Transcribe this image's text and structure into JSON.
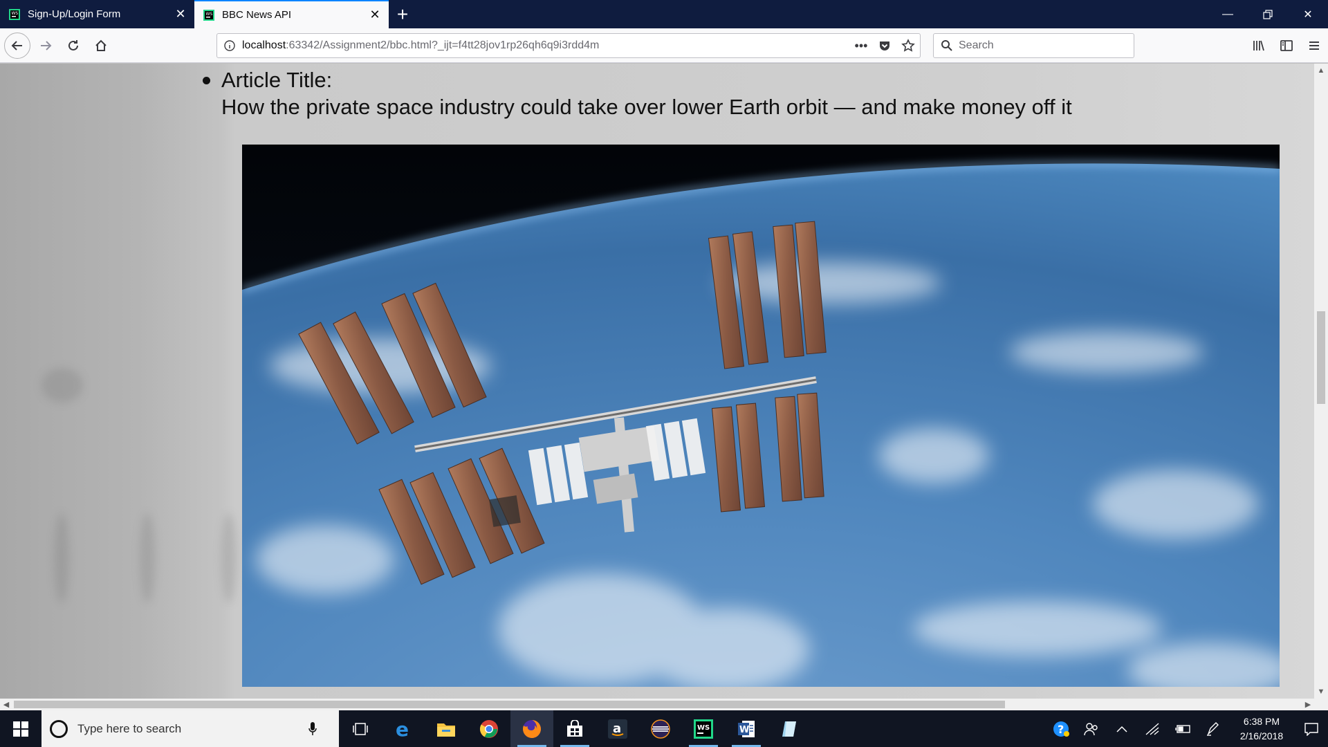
{
  "tabs": [
    {
      "title": "Sign-Up/Login Form",
      "active": false
    },
    {
      "title": "BBC News API",
      "active": true
    }
  ],
  "toolbar": {
    "url_host": "localhost",
    "url_rest": ":63342/Assignment2/bbc.html?_ijt=f4tt28jov1rp26qh6q9i3rdd4m",
    "search_placeholder": "Search",
    "page_actions_label": "•••"
  },
  "article": {
    "label": "Article Title:",
    "title": "How the private space industry could take over lower Earth orbit — and make money off it"
  },
  "taskbar": {
    "search_placeholder": "Type here to search",
    "time": "6:38 PM",
    "date": "2/16/2018",
    "apps": [
      "task-view",
      "edge",
      "file-explorer",
      "chrome",
      "firefox",
      "store",
      "amazon",
      "eclipse",
      "webstorm",
      "word",
      "notepad"
    ]
  },
  "colors": {
    "tabstrip": "#0f1c3f",
    "active_tab_accent": "#0a84ff",
    "taskbar": "#101522"
  }
}
